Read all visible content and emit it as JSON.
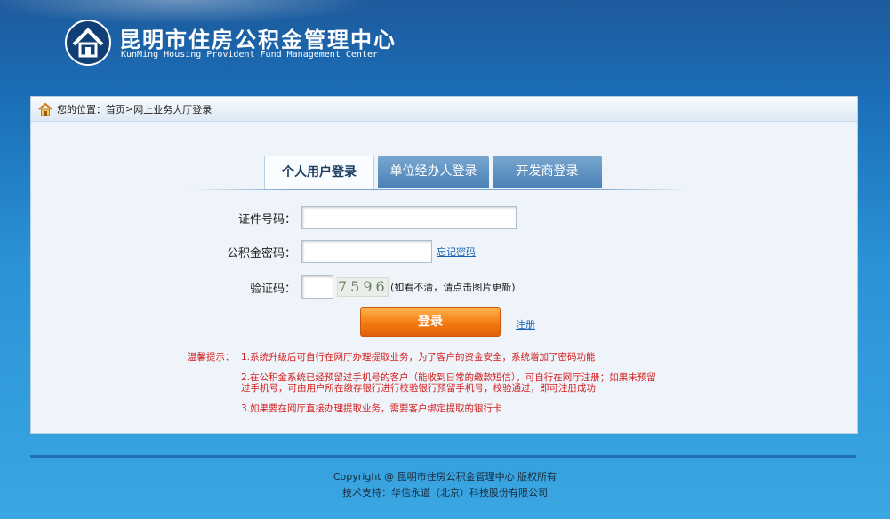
{
  "header": {
    "title_cn": "昆明市住房公积金管理中心",
    "title_en": "KunMing Housing Provident Fund Management Center"
  },
  "breadcrumb": {
    "prefix": "您的位置：",
    "home": "首页",
    "separator": " > ",
    "current": "网上业务大厅登录"
  },
  "tabs": [
    {
      "label": "个人用户登录",
      "active": true
    },
    {
      "label": "单位经办人登录",
      "active": false
    },
    {
      "label": "开发商登录",
      "active": false
    }
  ],
  "form": {
    "id_label": "证件号码：",
    "id_value": "",
    "pwd_label": "公积金密码：",
    "pwd_value": "",
    "forgot_link": "忘记密码",
    "captcha_label": "验证码：",
    "captcha_value": "",
    "captcha_code": "7596",
    "captcha_hint": "(如看不清，请点击图片更新)",
    "login_button": "登录",
    "register_link": "注册"
  },
  "notes": {
    "prefix": "温馨提示：",
    "item1": "1.系统升级后可自行在网厅办理提取业务，为了客户的资金安全，系统增加了密码功能",
    "item2_line1": "2.在公积金系统已经预留过手机号的客户（能收到日常的缴款短信），可自行在网厅注册；如果未预留",
    "item2_line2": "过手机号，可由用户所在缴存银行进行校验银行预留手机号，校验通过，即可注册成功",
    "item3": "3.如果要在网厅直接办理提取业务，需要客户绑定提取的银行卡"
  },
  "footer": {
    "copyright": "Copyright @ 昆明市住房公积金管理中心 版权所有",
    "support": "技术支持：华信永道（北京）科技股份有限公司"
  },
  "colors": {
    "accent_orange": "#f47a12",
    "note_red": "#d42020",
    "link_blue": "#1b62b8"
  },
  "icons": [
    "logo-icon",
    "home-icon"
  ]
}
